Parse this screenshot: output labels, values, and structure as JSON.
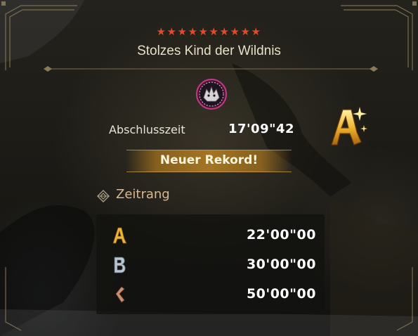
{
  "quest": {
    "stars": [
      "★",
      "★",
      "★",
      "★",
      "★",
      "★",
      "★",
      "★",
      "★",
      "★"
    ],
    "title": "Stolzes Kind der Wildnis"
  },
  "result": {
    "completion_label": "Abschlusszeit",
    "completion_time": "17'09\"42",
    "achieved_rank": "A",
    "record_banner": "Neuer Rekord!"
  },
  "time_ranks": {
    "heading": "Zeitrang",
    "rows": [
      {
        "rank": "A",
        "time": "22'00\"00",
        "color": "#e9b53a"
      },
      {
        "rank": "B",
        "time": "30'00\"00",
        "color": "#b9c6d0"
      },
      {
        "rank": "C",
        "time": "50'00\"00",
        "color": "#c98f72"
      }
    ]
  },
  "colors": {
    "star": "#e34a2a",
    "gold": "#e9b53a",
    "title_text": "#e8dfc8",
    "heading_text": "#d9b795"
  },
  "icons": [
    "monster-icon",
    "rank-a-badge-icon",
    "zeitrang-icon",
    "rank-a-icon",
    "rank-b-icon",
    "rank-c-icon"
  ]
}
